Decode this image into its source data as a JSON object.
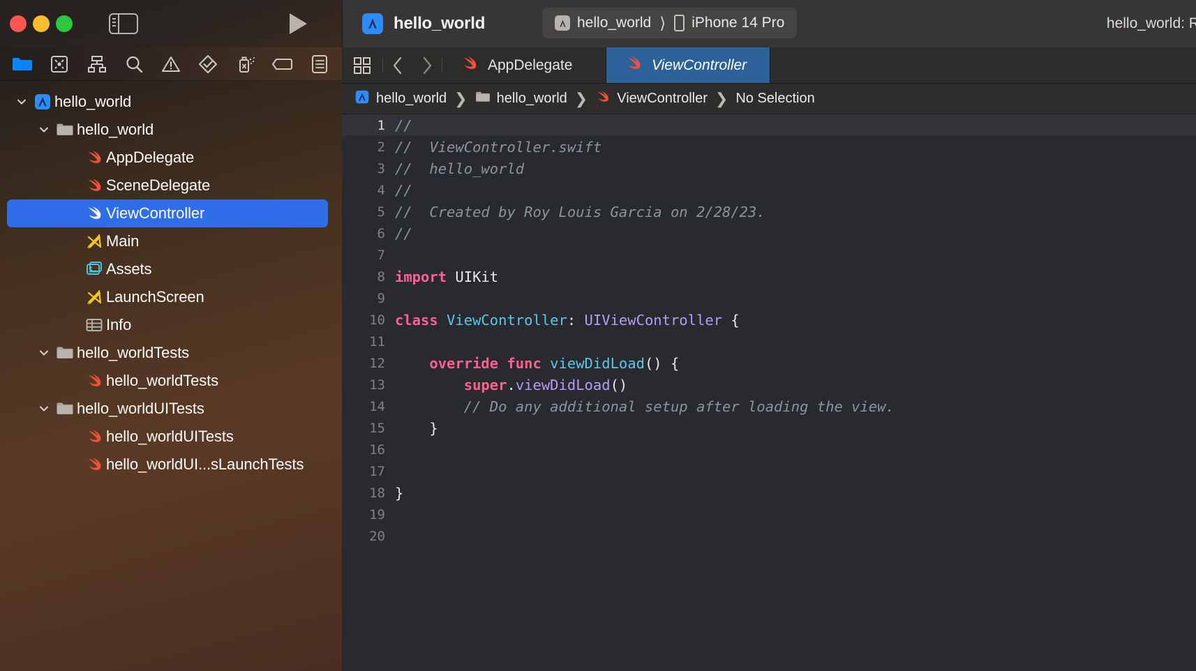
{
  "window": {
    "traffic_lights": [
      "close",
      "minimize",
      "zoom"
    ],
    "sidebar_toggle_name": "toggle-navigator",
    "run_button_label": "Run"
  },
  "titlebar": {
    "project_name": "hello_world",
    "scheme_name": "hello_world",
    "destination_name": "iPhone 14 Pro",
    "status": "hello_world: Read"
  },
  "navigator_toolbar": [
    {
      "name": "project-navigator-icon",
      "active": true
    },
    {
      "name": "source-control-navigator-icon",
      "active": false
    },
    {
      "name": "symbol-navigator-icon",
      "active": false
    },
    {
      "name": "find-navigator-icon",
      "active": false
    },
    {
      "name": "issue-navigator-icon",
      "active": false
    },
    {
      "name": "test-navigator-icon",
      "active": false
    },
    {
      "name": "debug-navigator-icon",
      "active": false
    },
    {
      "name": "breakpoint-navigator-icon",
      "active": false
    },
    {
      "name": "report-navigator-icon",
      "active": false
    }
  ],
  "navigator": {
    "items": [
      {
        "label": "hello_world",
        "icon": "app-icon",
        "indent": 0,
        "disclosure": "open",
        "selected": false
      },
      {
        "label": "hello_world",
        "icon": "folder-icon",
        "indent": 1,
        "disclosure": "open",
        "selected": false
      },
      {
        "label": "AppDelegate",
        "icon": "swift-icon",
        "indent": 2,
        "disclosure": "none",
        "selected": false
      },
      {
        "label": "SceneDelegate",
        "icon": "swift-icon",
        "indent": 2,
        "disclosure": "none",
        "selected": false
      },
      {
        "label": "ViewController",
        "icon": "swift-icon",
        "indent": 2,
        "disclosure": "none",
        "selected": true
      },
      {
        "label": "Main",
        "icon": "storyboard-icon",
        "indent": 2,
        "disclosure": "none",
        "selected": false
      },
      {
        "label": "Assets",
        "icon": "assets-icon",
        "indent": 2,
        "disclosure": "none",
        "selected": false
      },
      {
        "label": "LaunchScreen",
        "icon": "storyboard-icon",
        "indent": 2,
        "disclosure": "none",
        "selected": false
      },
      {
        "label": "Info",
        "icon": "plist-icon",
        "indent": 2,
        "disclosure": "none",
        "selected": false
      },
      {
        "label": "hello_worldTests",
        "icon": "folder-icon",
        "indent": 1,
        "disclosure": "open",
        "selected": false
      },
      {
        "label": "hello_worldTests",
        "icon": "swift-icon",
        "indent": 2,
        "disclosure": "none",
        "selected": false
      },
      {
        "label": "hello_worldUITests",
        "icon": "folder-icon",
        "indent": 1,
        "disclosure": "open",
        "selected": false
      },
      {
        "label": "hello_worldUITests",
        "icon": "swift-icon",
        "indent": 2,
        "disclosure": "none",
        "selected": false
      },
      {
        "label": "hello_worldUI...sLaunchTests",
        "icon": "swift-icon",
        "indent": 2,
        "disclosure": "none",
        "selected": false
      }
    ]
  },
  "editor": {
    "tabs": [
      {
        "label": "AppDelegate",
        "icon": "swift-icon",
        "active": false
      },
      {
        "label": "ViewController",
        "icon": "swift-icon",
        "active": true
      }
    ],
    "breadcrumb": [
      {
        "label": "hello_world",
        "icon": "app-icon"
      },
      {
        "label": "hello_world",
        "icon": "folder-icon"
      },
      {
        "label": "ViewController",
        "icon": "swift-icon"
      },
      {
        "label": "No Selection",
        "icon": "none"
      }
    ],
    "lines": [
      {
        "n": 1,
        "current": true,
        "tokens": [
          {
            "t": "//",
            "c": "cm"
          }
        ]
      },
      {
        "n": 2,
        "current": false,
        "tokens": [
          {
            "t": "//  ViewController.swift",
            "c": "cm"
          }
        ]
      },
      {
        "n": 3,
        "current": false,
        "tokens": [
          {
            "t": "//  hello_world",
            "c": "cm"
          }
        ]
      },
      {
        "n": 4,
        "current": false,
        "tokens": [
          {
            "t": "//",
            "c": "cm"
          }
        ]
      },
      {
        "n": 5,
        "current": false,
        "tokens": [
          {
            "t": "//  Created by Roy Louis Garcia on 2/28/23.",
            "c": "cm"
          }
        ]
      },
      {
        "n": 6,
        "current": false,
        "tokens": [
          {
            "t": "//",
            "c": "cm"
          }
        ]
      },
      {
        "n": 7,
        "current": false,
        "tokens": []
      },
      {
        "n": 8,
        "current": false,
        "tokens": [
          {
            "t": "import",
            "c": "kw"
          },
          {
            "t": " UIKit",
            "c": "pl"
          }
        ]
      },
      {
        "n": 9,
        "current": false,
        "tokens": []
      },
      {
        "n": 10,
        "current": false,
        "tokens": [
          {
            "t": "class",
            "c": "kw"
          },
          {
            "t": " ",
            "c": "pl"
          },
          {
            "t": "ViewController",
            "c": "type"
          },
          {
            "t": ": ",
            "c": "pl"
          },
          {
            "t": "UIViewController",
            "c": "utype"
          },
          {
            "t": " {",
            "c": "pl"
          }
        ]
      },
      {
        "n": 11,
        "current": false,
        "tokens": []
      },
      {
        "n": 12,
        "current": false,
        "tokens": [
          {
            "t": "    ",
            "c": "pl"
          },
          {
            "t": "override func",
            "c": "kw"
          },
          {
            "t": " ",
            "c": "pl"
          },
          {
            "t": "viewDidLoad",
            "c": "type"
          },
          {
            "t": "() {",
            "c": "pl"
          }
        ]
      },
      {
        "n": 13,
        "current": false,
        "tokens": [
          {
            "t": "        ",
            "c": "pl"
          },
          {
            "t": "super",
            "c": "kw"
          },
          {
            "t": ".",
            "c": "pl"
          },
          {
            "t": "viewDidLoad",
            "c": "prop"
          },
          {
            "t": "()",
            "c": "pl"
          }
        ]
      },
      {
        "n": 14,
        "current": false,
        "tokens": [
          {
            "t": "        // Do any additional setup after loading the view.",
            "c": "cm"
          }
        ]
      },
      {
        "n": 15,
        "current": false,
        "tokens": [
          {
            "t": "    }",
            "c": "pl"
          }
        ]
      },
      {
        "n": 16,
        "current": false,
        "tokens": []
      },
      {
        "n": 17,
        "current": false,
        "tokens": []
      },
      {
        "n": 18,
        "current": false,
        "tokens": [
          {
            "t": "}",
            "c": "pl"
          }
        ]
      },
      {
        "n": 19,
        "current": false,
        "tokens": []
      },
      {
        "n": 20,
        "current": false,
        "tokens": []
      }
    ]
  },
  "colors": {
    "accent_blue": "#2f6ee8",
    "active_tab_blue": "#2d6199",
    "swift_orange": "#f05138",
    "storyboard_yellow": "#f5c518",
    "assets_cyan": "#4cc3e0",
    "keyword_pink": "#fc6090",
    "type_cyan": "#5cc8e8",
    "utype_purple": "#b89af5",
    "comment_gray": "#8b949e",
    "editor_bg": "#292a2f"
  }
}
